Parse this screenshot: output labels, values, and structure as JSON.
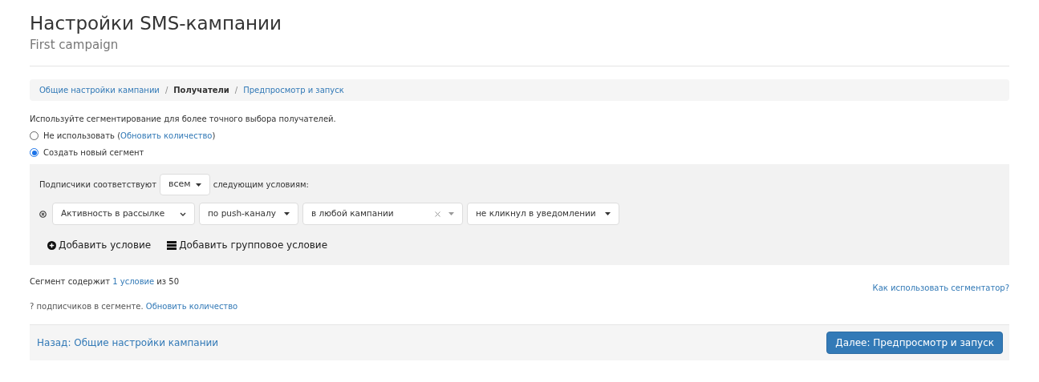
{
  "title": "Настройки SMS-кампании",
  "subtitle": "First campaign",
  "breadcrumb_separator": "/",
  "breadcrumbs": [
    {
      "label": "Общие настройки кампании",
      "selected": false
    },
    {
      "label": "Получатели",
      "selected": true
    },
    {
      "label": "Предпросмотр и запуск",
      "selected": false
    }
  ],
  "hint": "Используйте сегментирование для более точного выбора получателей.",
  "options": [
    {
      "label": "Не использовать (",
      "link": "Обновить количество",
      "suffix": ")",
      "selected": false
    },
    {
      "label": "Создать новый сегмент",
      "selected": true
    }
  ],
  "segment": {
    "match_prefix": "Подписчики соответствуют",
    "match_value": "всем",
    "match_suffix": "следующим условиям:",
    "conditions": [
      {
        "fields": [
          {
            "kind": "select",
            "value": "Активность в рассылке"
          },
          {
            "kind": "dropdown",
            "value": "по push-каналу"
          },
          {
            "kind": "combo",
            "value": "в любой кампании"
          },
          {
            "kind": "dropdown",
            "value": "не кликнул в уведомлении"
          }
        ]
      }
    ],
    "actions": [
      {
        "kind": "add",
        "label": "Добавить условие"
      },
      {
        "kind": "group",
        "label": "Добавить групповое условие"
      }
    ]
  },
  "count": {
    "prefix": "Сегмент содержит",
    "value": "1 условие",
    "suffix": "из 50"
  },
  "help_link": "Как использовать сегментатор?",
  "subscribers": {
    "text": "? подписчиков в сегменте.",
    "link": "Обновить количество"
  },
  "footer": {
    "back": "Назад: Общие настройки кампании",
    "next": "Далее: Предпросмотр и запуск"
  }
}
